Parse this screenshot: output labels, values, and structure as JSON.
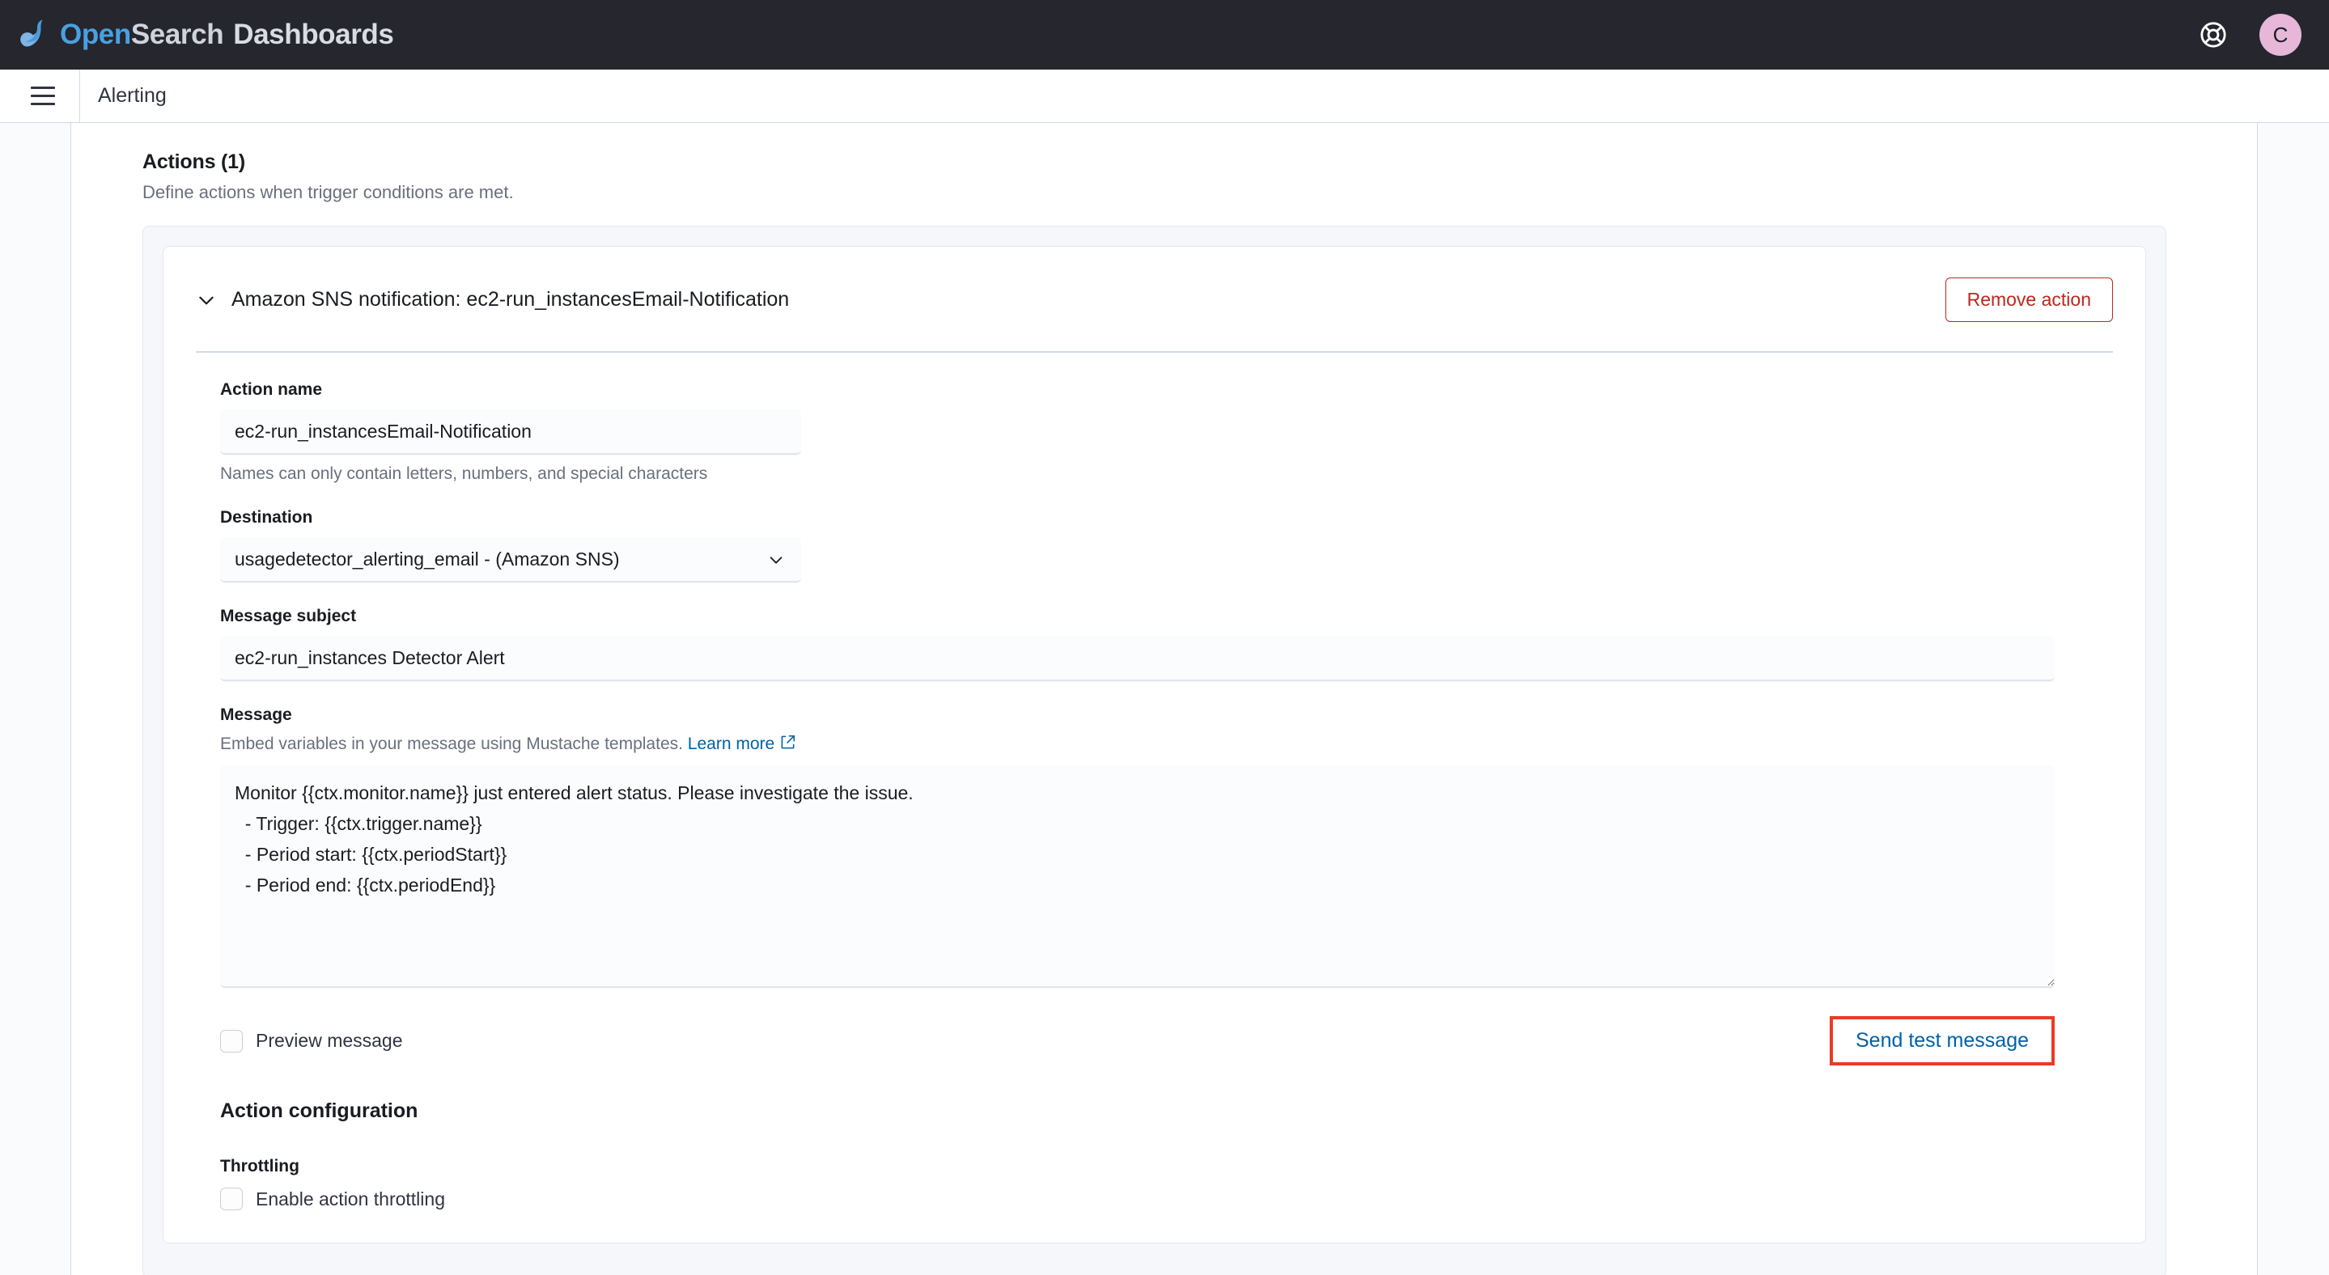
{
  "header": {
    "brand_open": "Open",
    "brand_search": "Search",
    "brand_dashboards": "Dashboards",
    "help_icon": "life-ring-help-icon",
    "avatar_initial": "C",
    "avatar_color": "#e6b7d9"
  },
  "nav": {
    "menu_icon": "hamburger-menu-icon",
    "breadcrumb": "Alerting"
  },
  "section": {
    "title": "Actions (1)",
    "description": "Define actions when trigger conditions are met."
  },
  "action": {
    "accordion_title": "Amazon SNS notification: ec2-run_instancesEmail-Notification",
    "chevron_icon": "chevron-down-icon",
    "remove_label": "Remove action",
    "remove_color": "#bd271e",
    "name_label": "Action name",
    "name_value": "ec2-run_instancesEmail-Notification",
    "name_help": "Names can only contain letters, numbers, and special characters",
    "destination_label": "Destination",
    "destination_value": "usagedetector_alerting_email - (Amazon SNS)",
    "destination_options": [
      "usagedetector_alerting_email - (Amazon SNS)"
    ],
    "subject_label": "Message subject",
    "subject_value": "ec2-run_instances Detector Alert",
    "message_label": "Message",
    "message_help_text": "Embed variables in your message using Mustache templates.",
    "message_help_link": "Learn more",
    "message_link_icon": "external-link-icon",
    "message_value": "Monitor {{ctx.monitor.name}} just entered alert status. Please investigate the issue.\n  - Trigger: {{ctx.trigger.name}}\n  - Period start: {{ctx.periodStart}}\n  - Period end: {{ctx.periodEnd}}",
    "preview_label": "Preview message",
    "preview_checked": false,
    "send_test_label": "Send test message",
    "send_test_color": "#0061a6",
    "highlight_color": "#ec3b25",
    "config_title": "Action configuration",
    "throttling_label": "Throttling",
    "throttling_checkbox_label": "Enable action throttling",
    "throttling_checked": false
  }
}
